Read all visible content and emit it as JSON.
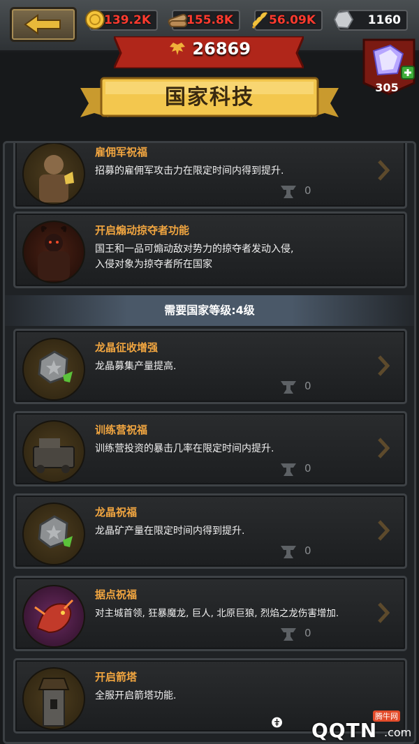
{
  "topbar": {
    "back_label": "back",
    "resources": [
      {
        "name": "gold",
        "icon": "gold-coin-icon",
        "value": "139.2K",
        "color": "#ff3b2f"
      },
      {
        "name": "wood",
        "icon": "wood-log-icon",
        "value": "155.8K",
        "color": "#ff3b2f"
      },
      {
        "name": "food",
        "icon": "wheat-icon",
        "value": "56.09K",
        "color": "#ff3b2f"
      },
      {
        "name": "stone",
        "icon": "stone-icon",
        "value": "1160",
        "color": "#ffffff"
      }
    ]
  },
  "header": {
    "score": "26869",
    "title": "国家科技",
    "gem_count": "305"
  },
  "cards_top": [
    {
      "title": "雇佣军祝福",
      "desc": "招募的雇佣军攻击力在限定时间内得到提升.",
      "cost": "0",
      "icon": "mercenary-icon"
    },
    {
      "title": "开启煽动掠夺者功能",
      "desc_lines": [
        "国王和一品可煽动敌对势力的掠夺者发动入侵,",
        "入侵对象为掠夺者所在国家"
      ],
      "icon": "raider-icon"
    }
  ],
  "section": {
    "label": "需要国家等级:4级"
  },
  "cards": [
    {
      "title": "龙晶征收增强",
      "desc": "龙晶募集产量提高.",
      "cost": "0",
      "icon": "dragon-crystal-icon"
    },
    {
      "title": "训练营祝福",
      "desc": "训练营投资的暴击几率在限定时间内提升.",
      "cost": "0",
      "icon": "training-camp-icon"
    },
    {
      "title": "龙晶祝福",
      "desc": "龙晶矿产量在限定时间内得到提升.",
      "cost": "0",
      "icon": "dragon-crystal-icon"
    },
    {
      "title": "据点祝福",
      "desc": "对主城首领, 狂暴魔龙, 巨人, 北原巨狼, 烈焰之龙伤害增加.",
      "cost": "0",
      "icon": "red-dragon-icon"
    },
    {
      "title": "开启箭塔",
      "desc": "全服开启箭塔功能.",
      "icon": "arrow-tower-icon"
    }
  ],
  "watermark": {
    "brand": "QQTN",
    "domain": ".com",
    "tag": "腾牛网"
  }
}
